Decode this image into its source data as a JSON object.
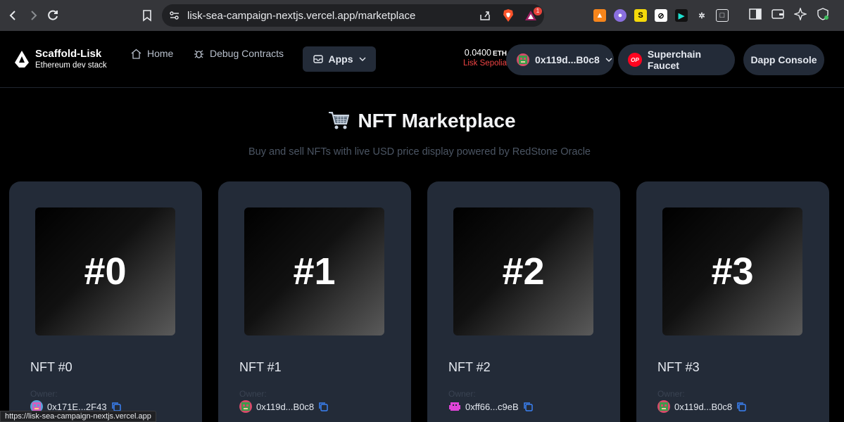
{
  "browser": {
    "url": "lisk-sea-campaign-nextjs.vercel.app/marketplace",
    "rewards_badge": "1",
    "status_url": "https://lisk-sea-campaign-nextjs.vercel.app"
  },
  "header": {
    "brand_title": "Scaffold-Lisk",
    "brand_subtitle": "Ethereum dev stack",
    "nav": [
      {
        "label": "Home",
        "icon": "home-icon"
      },
      {
        "label": "Debug Contracts",
        "icon": "bug-icon"
      }
    ],
    "apps_label": "Apps",
    "balance_value": "0.0400",
    "balance_unit": "ETH",
    "network": "Lisk Sepolia",
    "account": "0x119d...B0c8",
    "faucet_badge": "OP",
    "faucet_label": "Superchain Faucet",
    "console_label": "Dapp Console"
  },
  "colors": {
    "accent_red": "#ef4444",
    "card_bg": "#232b38",
    "copy_blue": "#3b82f6"
  },
  "main": {
    "title": "NFT Marketplace",
    "subtitle": "Buy and sell NFTs with live USD price display powered by RedStone Oracle",
    "owner_label": "Owner:",
    "nfts": [
      {
        "image_label": "#0",
        "name": "NFT #0",
        "owner": "0x171E...2F43"
      },
      {
        "image_label": "#1",
        "name": "NFT #1",
        "owner": "0x119d...B0c8"
      },
      {
        "image_label": "#2",
        "name": "NFT #2",
        "owner": "0xff66...c9eB"
      },
      {
        "image_label": "#3",
        "name": "NFT #3",
        "owner": "0x119d...B0c8"
      }
    ]
  }
}
